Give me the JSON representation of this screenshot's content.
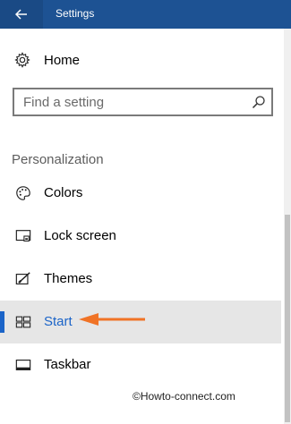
{
  "window": {
    "title": "Settings"
  },
  "home": {
    "label": "Home",
    "icon": "gear-icon"
  },
  "search": {
    "placeholder": "Find a setting",
    "icon": "search-icon"
  },
  "section": {
    "title": "Personalization"
  },
  "nav": {
    "items": [
      {
        "label": "Colors",
        "icon": "palette-icon"
      },
      {
        "label": "Lock screen",
        "icon": "lock-screen-icon"
      },
      {
        "label": "Themes",
        "icon": "themes-icon"
      },
      {
        "label": "Start",
        "icon": "start-icon",
        "selected": true
      },
      {
        "label": "Taskbar",
        "icon": "taskbar-icon"
      }
    ]
  },
  "watermark": "©Howto-connect.com",
  "colors": {
    "titlebar": "#1d5293",
    "accent": "#1b64c8",
    "selected_bg": "#e6e6e6",
    "arrow": "#f07326"
  }
}
